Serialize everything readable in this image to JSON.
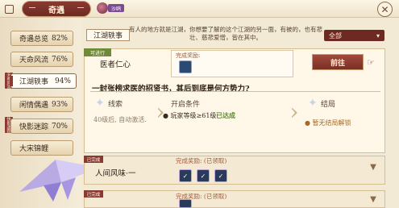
{
  "header": {
    "tab_title": "奇遇",
    "player_name": "沙鸥"
  },
  "sidebar": {
    "items": [
      {
        "label": "奇遇总览",
        "value": "82%"
      },
      {
        "label": "天命风流",
        "value": "76%"
      },
      {
        "label": "江湖轶事",
        "value": "94%"
      },
      {
        "label": "闲情偶遇",
        "value": "93%"
      },
      {
        "label": "快影迷踪",
        "value": "70%"
      },
      {
        "label": "大宋锦鲤",
        "value": ""
      }
    ],
    "side_tags": [
      "天命风流",
      "快影迷踪"
    ]
  },
  "main": {
    "section_label": "江湖轶事",
    "description": "有人的地方就是江湖，你想要了解的这个江湖的另一面，有被的，也有悲壮、慈悲爱憎，皆在其中。",
    "filter": {
      "selected": "全部"
    }
  },
  "card": {
    "ribbon": "可进行",
    "title": "医者仁心",
    "reward_label": "完成奖励:",
    "go_button": "前往",
    "question": "一封张榜求医的招贤书，其后到底是何方势力?",
    "columns": [
      {
        "title": "线索",
        "text": "40级后, 自动激活."
      },
      {
        "title": "开启条件",
        "condition": "● 玩家等级≥61级",
        "status": "已达成"
      },
      {
        "title": "结局",
        "text": "● 暂无结局解锁"
      }
    ]
  },
  "rows": [
    {
      "tag": "已完成",
      "title": "人间风味·一",
      "reward_label": "完成奖励: (已领取)",
      "reward_count": 3
    },
    {
      "tag": "已完成",
      "title": "",
      "reward_label": "完成奖励: (已领取)",
      "reward_count": 1
    }
  ],
  "colors": {
    "accent": "#8a3a31",
    "ribbon_green": "#6f8b3a",
    "background": "#f3ead6"
  }
}
